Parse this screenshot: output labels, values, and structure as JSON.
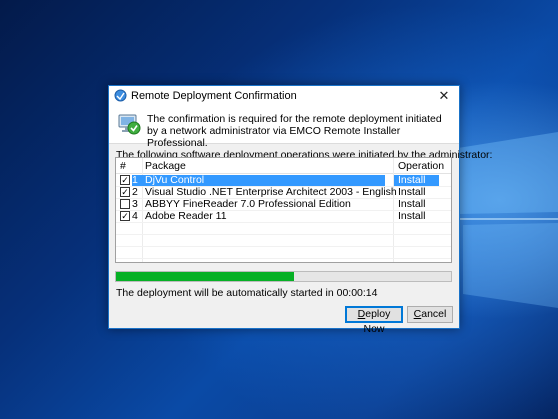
{
  "dialog": {
    "title": "Remote Deployment Confirmation",
    "close_label": "✕",
    "header_text": "The confirmation is required for the remote deployment initiated by a network administrator via EMCO Remote Installer Professional.",
    "list_caption": "The following software deployment operations were initiated by the administrator:",
    "columns": {
      "num": "#",
      "package": "Package",
      "operation": "Operation"
    },
    "rows": [
      {
        "num": "1",
        "package": "DjVu Control",
        "operation": "Install",
        "checked": true,
        "selected": true
      },
      {
        "num": "2",
        "package": "Visual Studio .NET Enterprise Architect 2003 - English",
        "operation": "Install",
        "checked": true,
        "selected": false
      },
      {
        "num": "3",
        "package": "ABBYY FineReader 7.0 Professional Edition",
        "operation": "Install",
        "checked": false,
        "selected": false
      },
      {
        "num": "4",
        "package": "Adobe Reader 11",
        "operation": "Install",
        "checked": true,
        "selected": false
      }
    ],
    "progress_percent": 53,
    "status_text": "The deployment will be automatically started in 00:00:14",
    "deploy_button": {
      "prefix": "",
      "accel": "D",
      "rest": "eploy Now"
    },
    "cancel_button": {
      "prefix": "",
      "accel": "C",
      "rest": "ancel"
    }
  },
  "colors": {
    "selection": "#3399ff",
    "progress": "#06b025",
    "accent": "#0078d7"
  }
}
